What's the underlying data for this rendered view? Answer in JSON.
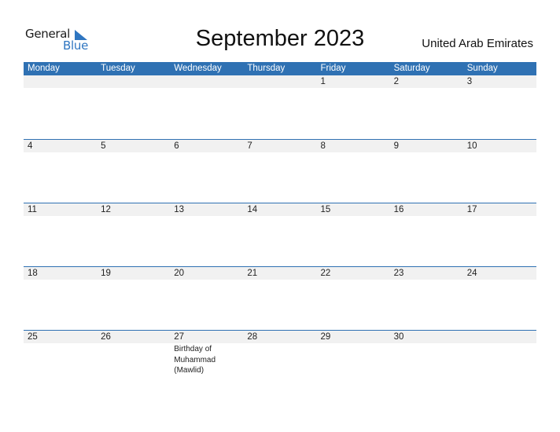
{
  "logo": {
    "line1": "General",
    "line2": "Blue",
    "accent_color": "#2f76c1"
  },
  "title": "September 2023",
  "country": "United Arab Emirates",
  "header_color": "#2f71b3",
  "weekdays": [
    "Monday",
    "Tuesday",
    "Wednesday",
    "Thursday",
    "Friday",
    "Saturday",
    "Sunday"
  ],
  "weeks": [
    {
      "days": [
        "",
        "",
        "",
        "",
        "1",
        "2",
        "3"
      ],
      "events": [
        "",
        "",
        "",
        "",
        "",
        "",
        ""
      ]
    },
    {
      "days": [
        "4",
        "5",
        "6",
        "7",
        "8",
        "9",
        "10"
      ],
      "events": [
        "",
        "",
        "",
        "",
        "",
        "",
        ""
      ]
    },
    {
      "days": [
        "11",
        "12",
        "13",
        "14",
        "15",
        "16",
        "17"
      ],
      "events": [
        "",
        "",
        "",
        "",
        "",
        "",
        ""
      ]
    },
    {
      "days": [
        "18",
        "19",
        "20",
        "21",
        "22",
        "23",
        "24"
      ],
      "events": [
        "",
        "",
        "",
        "",
        "",
        "",
        ""
      ]
    },
    {
      "days": [
        "25",
        "26",
        "27",
        "28",
        "29",
        "30",
        ""
      ],
      "events": [
        "",
        "",
        "Birthday of Muhammad (Mawlid)",
        "",
        "",
        "",
        ""
      ]
    }
  ]
}
